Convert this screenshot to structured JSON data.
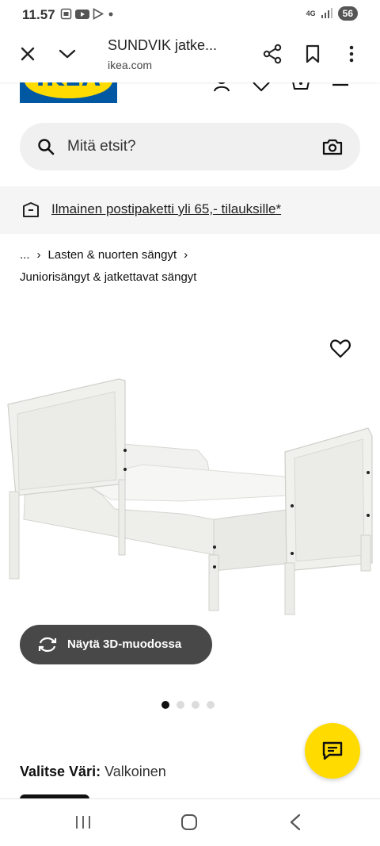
{
  "status_bar": {
    "time": "11.57",
    "network": "4G",
    "battery": "56"
  },
  "browser": {
    "title": "SUNDVIK jatke...",
    "url": "ikea.com"
  },
  "header": {
    "logo_text": "IKEA"
  },
  "search": {
    "placeholder": "Mitä etsit?"
  },
  "promo": {
    "text": "Ilmainen postipaketti yli 65,- tilauksille*"
  },
  "breadcrumb": {
    "ellipsis": "...",
    "separator": "›",
    "parent": "Lasten & nuorten sängyt",
    "current": "Juniorisängyt & jatkettavat sängyt"
  },
  "gallery": {
    "image_count": 4,
    "active_index": 0
  },
  "view_3d": {
    "label": "Näytä 3D-muodossa"
  },
  "color": {
    "label": "Valitse Väri:",
    "value": "Valkoinen"
  },
  "colors": {
    "brand_blue": "#0058a3",
    "brand_yellow": "#ffdb00",
    "button_dark": "#484848"
  }
}
